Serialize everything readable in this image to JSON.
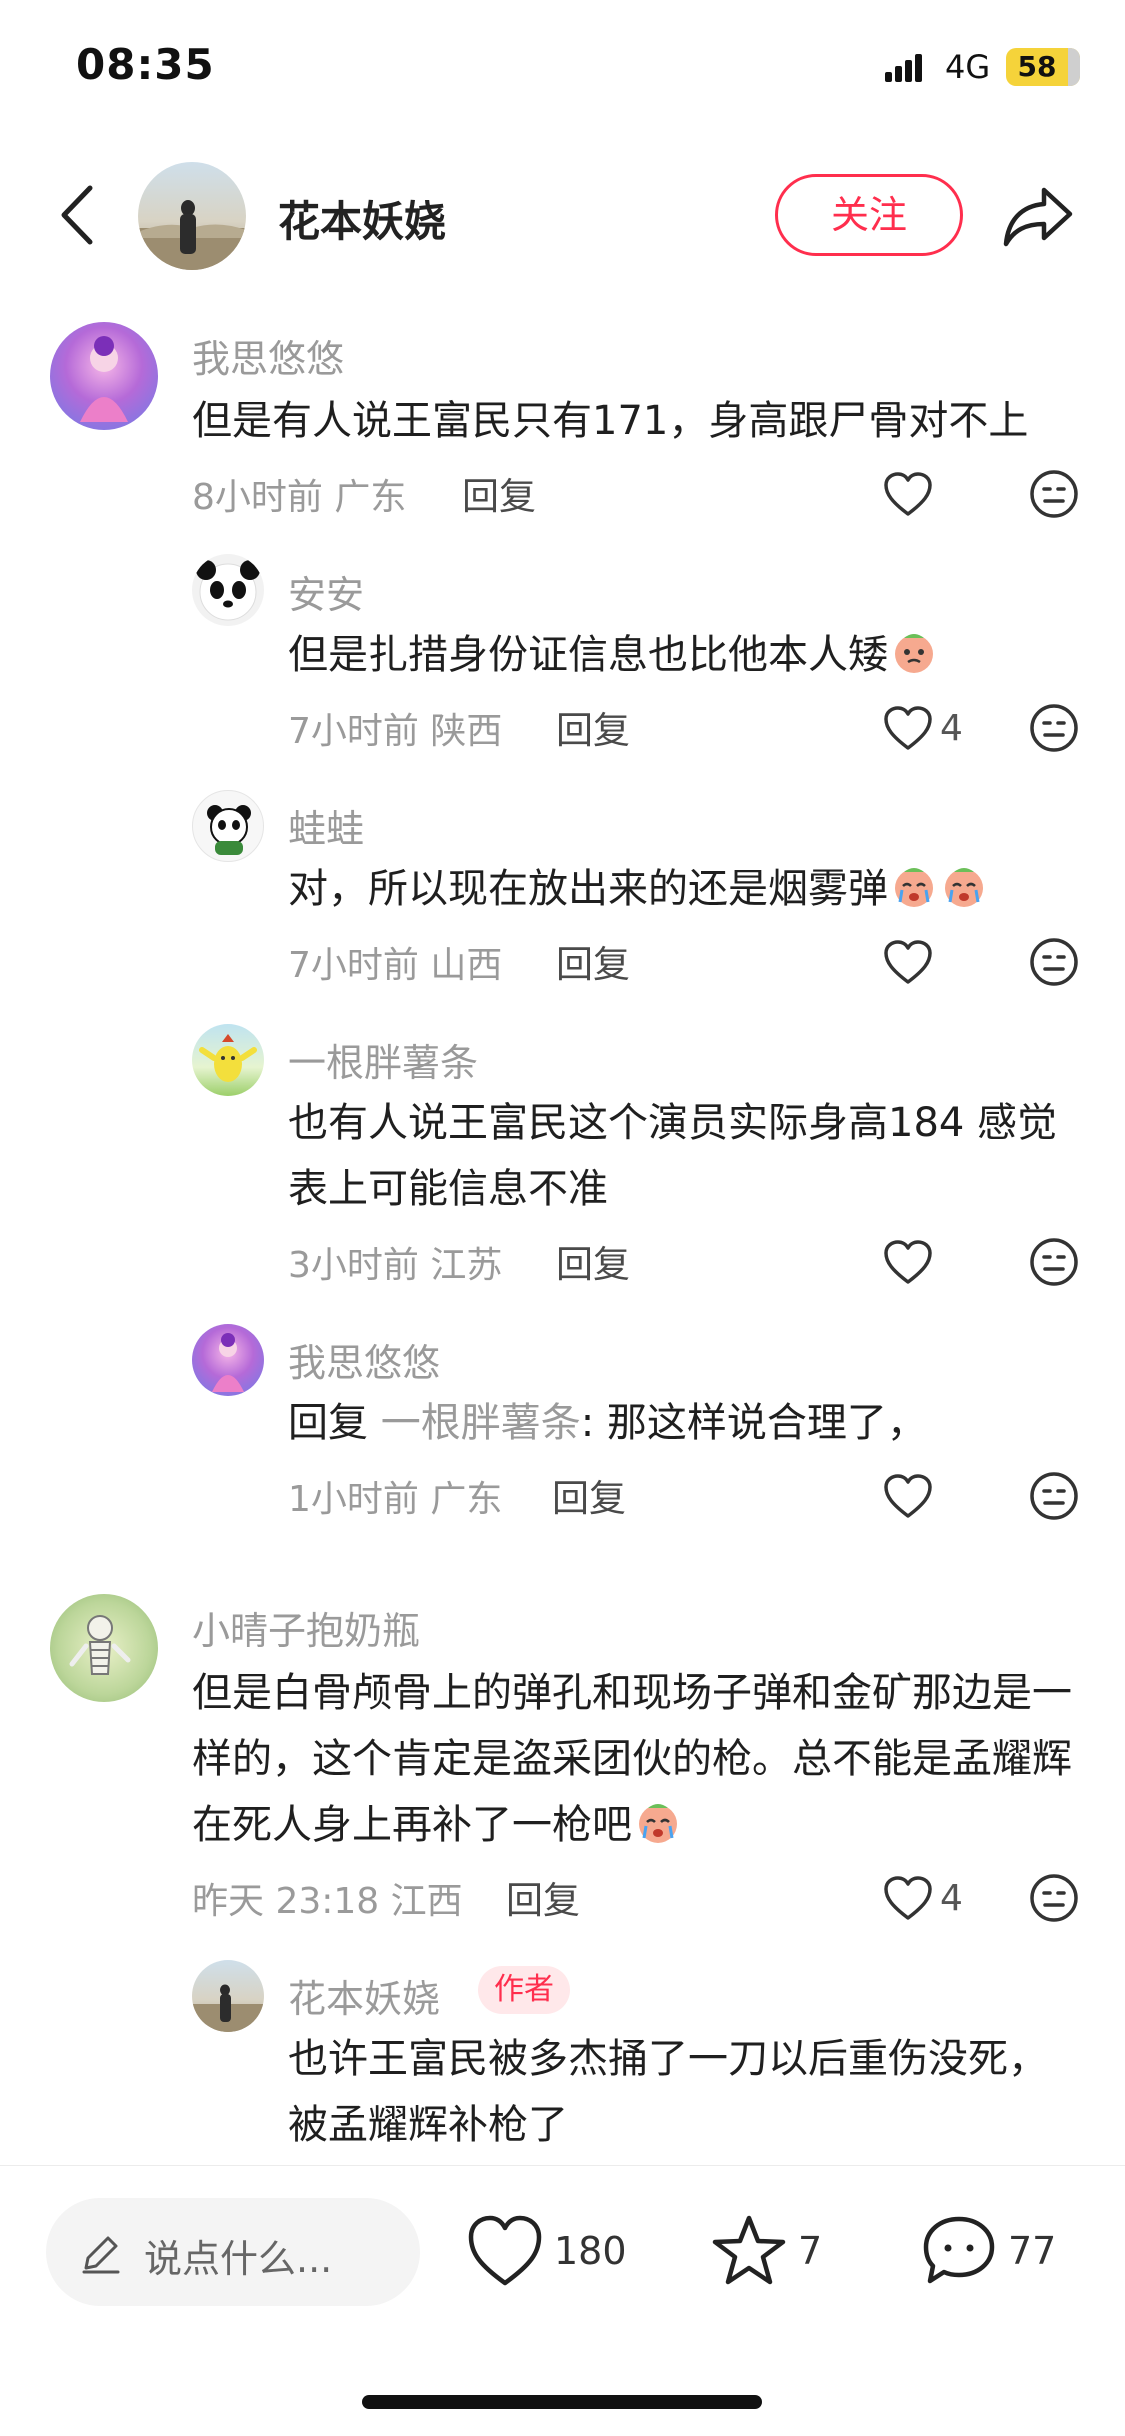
{
  "status_bar": {
    "time": "08:35",
    "network": "4G",
    "battery": "58"
  },
  "header": {
    "author_name": "花本妖娆",
    "follow_label": "关注"
  },
  "comments": [
    {
      "user": "我思悠悠",
      "text": "但是有人说王富民只有171，身高跟尸骨对不上",
      "meta": "8小时前 广东",
      "reply_label": "回复",
      "likes": ""
    },
    {
      "user": "安安",
      "text": "但是扎措身份证信息也比他本人矮",
      "meta": "7小时前 陕西",
      "reply_label": "回复",
      "likes": "4"
    },
    {
      "user": "蛙蛙",
      "text": "对，所以现在放出来的还是烟雾弹",
      "meta": "7小时前 山西",
      "reply_label": "回复",
      "likes": ""
    },
    {
      "user": "一根胖薯条",
      "text": "也有人说王富民这个演员实际身高184 感觉表上可能信息不准",
      "meta": "3小时前 江苏",
      "reply_label": "回复",
      "likes": ""
    },
    {
      "user": "我思悠悠",
      "reply_prefix": "回复",
      "reply_to": "一根胖薯条",
      "text": ": 那这样说合理了，",
      "meta": "1小时前 广东",
      "reply_label": "回复",
      "likes": ""
    },
    {
      "user": "小晴子抱奶瓶",
      "text": "但是白骨颅骨上的弹孔和现场子弹和金矿那边是一样的，这个肯定是盗采团伙的枪。总不能是孟耀辉在死人身上再补了一枪吧",
      "meta": "昨天 23:18 江西",
      "reply_label": "回复",
      "likes": "4"
    },
    {
      "user": "花本妖娆",
      "badge": "作者",
      "text": "也许王富民被多杰捅了一刀以后重伤没死，被孟耀辉补枪了"
    }
  ],
  "bottom_bar": {
    "input_placeholder": "说点什么...",
    "likes": "180",
    "favorites": "7",
    "comments": "77"
  },
  "colors": {
    "accent": "#ff2e4d",
    "muted_text": "#9a9a9a"
  },
  "icons": [
    "back-icon",
    "share-icon",
    "heart-icon",
    "dislike-face-icon",
    "pencil-icon",
    "star-icon",
    "comment-bubble-icon",
    "crying-face-icon"
  ]
}
